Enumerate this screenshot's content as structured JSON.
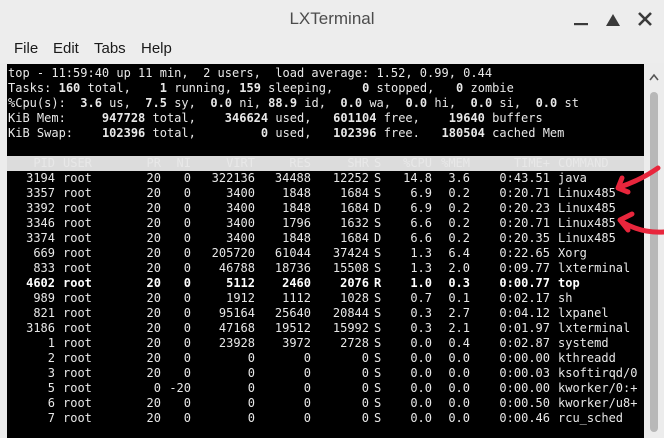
{
  "window": {
    "title": "LXTerminal",
    "buttons": [
      "minimize-icon",
      "maximize-icon",
      "close-icon"
    ]
  },
  "menubar": {
    "items": [
      "File",
      "Edit",
      "Tabs",
      "Help"
    ]
  },
  "summary": {
    "line1": "top - 11:59:40 up 11 min,  2 users,  load average: 1.52, 0.99, 0.44",
    "tasks": {
      "label": "Tasks:",
      "total": "160",
      "running": "1",
      "sleeping": "159",
      "stopped": "0",
      "zombie": "0"
    },
    "cpu": {
      "label": "%Cpu(s):",
      "us": "3.6",
      "sy": "7.5",
      "ni": "0.0",
      "id": "88.9",
      "wa": "0.0",
      "hi": "0.0",
      "si": "0.0",
      "st": "0.0"
    },
    "mem": {
      "label": "KiB Mem:",
      "total": "947728",
      "used": "346624",
      "free": "601104",
      "buffers": "19640"
    },
    "swap": {
      "label": "KiB Swap:",
      "total": "102396",
      "used": "0",
      "free": "102396",
      "cached": "180504"
    }
  },
  "columns": [
    "PID",
    "USER",
    "PR",
    "NI",
    "VIRT",
    "RES",
    "SHR",
    "S",
    "%CPU",
    "%MEM",
    "TIME+",
    "COMMAND"
  ],
  "processes": [
    {
      "pid": "3194",
      "user": "root",
      "pr": "20",
      "ni": "0",
      "virt": "322136",
      "res": "34488",
      "shr": "12252",
      "s": "S",
      "cpu": "14.8",
      "mem": "3.6",
      "time": "0:43.51",
      "cmd": "java"
    },
    {
      "pid": "3357",
      "user": "root",
      "pr": "20",
      "ni": "0",
      "virt": "3400",
      "res": "1848",
      "shr": "1684",
      "s": "S",
      "cpu": "6.9",
      "mem": "0.2",
      "time": "0:20.71",
      "cmd": "Linux485"
    },
    {
      "pid": "3392",
      "user": "root",
      "pr": "20",
      "ni": "0",
      "virt": "3400",
      "res": "1848",
      "shr": "1684",
      "s": "D",
      "cpu": "6.9",
      "mem": "0.2",
      "time": "0:20.23",
      "cmd": "Linux485"
    },
    {
      "pid": "3346",
      "user": "root",
      "pr": "20",
      "ni": "0",
      "virt": "3400",
      "res": "1796",
      "shr": "1632",
      "s": "S",
      "cpu": "6.6",
      "mem": "0.2",
      "time": "0:20.71",
      "cmd": "Linux485"
    },
    {
      "pid": "3374",
      "user": "root",
      "pr": "20",
      "ni": "0",
      "virt": "3400",
      "res": "1848",
      "shr": "1684",
      "s": "D",
      "cpu": "6.6",
      "mem": "0.2",
      "time": "0:20.35",
      "cmd": "Linux485"
    },
    {
      "pid": "669",
      "user": "root",
      "pr": "20",
      "ni": "0",
      "virt": "205720",
      "res": "61044",
      "shr": "37424",
      "s": "S",
      "cpu": "1.3",
      "mem": "6.4",
      "time": "0:22.65",
      "cmd": "Xorg"
    },
    {
      "pid": "833",
      "user": "root",
      "pr": "20",
      "ni": "0",
      "virt": "46788",
      "res": "18736",
      "shr": "15508",
      "s": "S",
      "cpu": "1.3",
      "mem": "2.0",
      "time": "0:09.77",
      "cmd": "lxterminal"
    },
    {
      "pid": "4602",
      "user": "root",
      "pr": "20",
      "ni": "0",
      "virt": "5112",
      "res": "2460",
      "shr": "2076",
      "s": "R",
      "cpu": "1.0",
      "mem": "0.3",
      "time": "0:00.77",
      "cmd": "top",
      "bold": true
    },
    {
      "pid": "989",
      "user": "root",
      "pr": "20",
      "ni": "0",
      "virt": "1912",
      "res": "1112",
      "shr": "1028",
      "s": "S",
      "cpu": "0.7",
      "mem": "0.1",
      "time": "0:02.17",
      "cmd": "sh"
    },
    {
      "pid": "821",
      "user": "root",
      "pr": "20",
      "ni": "0",
      "virt": "95164",
      "res": "25640",
      "shr": "20844",
      "s": "S",
      "cpu": "0.3",
      "mem": "2.7",
      "time": "0:04.12",
      "cmd": "lxpanel"
    },
    {
      "pid": "3186",
      "user": "root",
      "pr": "20",
      "ni": "0",
      "virt": "47168",
      "res": "19512",
      "shr": "15992",
      "s": "S",
      "cpu": "0.3",
      "mem": "2.1",
      "time": "0:01.97",
      "cmd": "lxterminal"
    },
    {
      "pid": "1",
      "user": "root",
      "pr": "20",
      "ni": "0",
      "virt": "23928",
      "res": "3972",
      "shr": "2728",
      "s": "S",
      "cpu": "0.0",
      "mem": "0.4",
      "time": "0:02.87",
      "cmd": "systemd"
    },
    {
      "pid": "2",
      "user": "root",
      "pr": "20",
      "ni": "0",
      "virt": "0",
      "res": "0",
      "shr": "0",
      "s": "S",
      "cpu": "0.0",
      "mem": "0.0",
      "time": "0:00.00",
      "cmd": "kthreadd"
    },
    {
      "pid": "3",
      "user": "root",
      "pr": "20",
      "ni": "0",
      "virt": "0",
      "res": "0",
      "shr": "0",
      "s": "S",
      "cpu": "0.0",
      "mem": "0.0",
      "time": "0:00.03",
      "cmd": "ksoftirqd/0"
    },
    {
      "pid": "5",
      "user": "root",
      "pr": "0",
      "ni": "-20",
      "virt": "0",
      "res": "0",
      "shr": "0",
      "s": "S",
      "cpu": "0.0",
      "mem": "0.0",
      "time": "0:00.00",
      "cmd": "kworker/0:+"
    },
    {
      "pid": "6",
      "user": "root",
      "pr": "20",
      "ni": "0",
      "virt": "0",
      "res": "0",
      "shr": "0",
      "s": "S",
      "cpu": "0.0",
      "mem": "0.0",
      "time": "0:00.50",
      "cmd": "kworker/u8+"
    },
    {
      "pid": "7",
      "user": "root",
      "pr": "20",
      "ni": "0",
      "virt": "0",
      "res": "0",
      "shr": "0",
      "s": "S",
      "cpu": "0.0",
      "mem": "0.0",
      "time": "0:00.46",
      "cmd": "rcu_sched"
    }
  ],
  "annotation_color": "#e8263c",
  "scrollbar": {
    "icon": "chevron-up-icon"
  }
}
